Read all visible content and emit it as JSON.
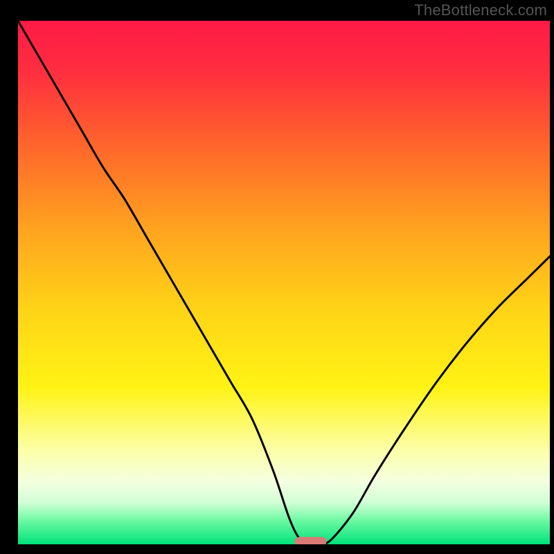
{
  "watermark": "TheBottleneck.com",
  "chart_data": {
    "type": "line",
    "title": "",
    "xlabel": "",
    "ylabel": "",
    "xlim": [
      0,
      100
    ],
    "ylim": [
      0,
      100
    ],
    "background_gradient_stops": [
      {
        "offset": 0.0,
        "color": "#ff1a47"
      },
      {
        "offset": 0.1,
        "color": "#ff2f3f"
      },
      {
        "offset": 0.25,
        "color": "#ff6a2a"
      },
      {
        "offset": 0.4,
        "color": "#ffa41f"
      },
      {
        "offset": 0.55,
        "color": "#ffd317"
      },
      {
        "offset": 0.7,
        "color": "#fff314"
      },
      {
        "offset": 0.82,
        "color": "#fcffa8"
      },
      {
        "offset": 0.88,
        "color": "#f4ffe0"
      },
      {
        "offset": 0.92,
        "color": "#d2ffd6"
      },
      {
        "offset": 0.955,
        "color": "#6cf9a2"
      },
      {
        "offset": 1.0,
        "color": "#00e27a"
      }
    ],
    "series": [
      {
        "name": "bottleneck-curve",
        "x": [
          0,
          4,
          8,
          12,
          16,
          20,
          24,
          28,
          32,
          36,
          40,
          44,
          48,
          51,
          53,
          55,
          57,
          59,
          63,
          67,
          72,
          78,
          84,
          90,
          96,
          100
        ],
        "y": [
          100,
          93,
          86,
          79,
          72,
          66,
          59,
          52,
          45,
          38,
          31,
          24,
          14,
          5,
          1,
          0,
          0,
          1,
          6,
          13,
          21,
          30,
          38,
          45,
          51,
          55
        ]
      }
    ],
    "marker": {
      "name": "optimal-range",
      "x_center": 55,
      "y": 0.5,
      "width": 6,
      "height": 1.8,
      "color": "#d87b74"
    }
  }
}
